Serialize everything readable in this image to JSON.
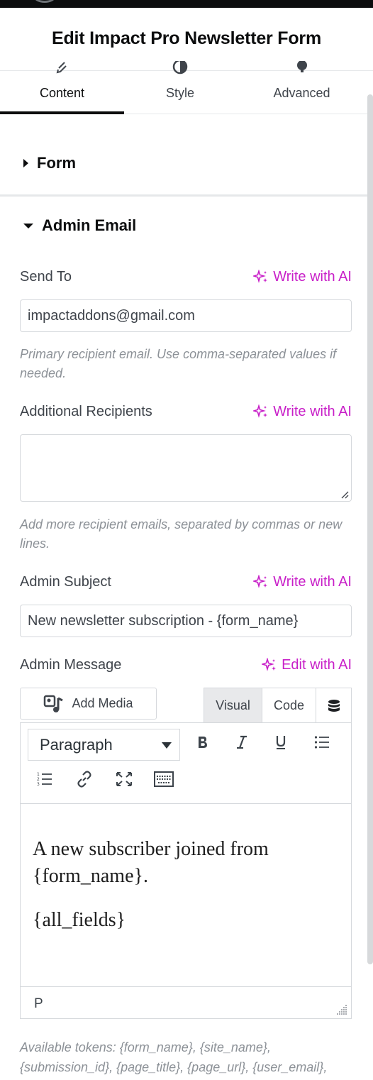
{
  "header": {
    "title": "Edit Impact Pro Newsletter Form"
  },
  "tabs": [
    {
      "label": "Content",
      "icon": "pencil-icon",
      "active": true
    },
    {
      "label": "Style",
      "icon": "half-circle-icon",
      "active": false
    },
    {
      "label": "Advanced",
      "icon": "gear-icon",
      "active": false
    }
  ],
  "sections": {
    "form": {
      "title": "Form",
      "expanded": false
    },
    "admin_email": {
      "title": "Admin Email",
      "expanded": true
    }
  },
  "fields": {
    "send_to": {
      "label": "Send To",
      "ai_label": "Write with AI",
      "value": "impactaddons@gmail.com",
      "help": "Primary recipient email. Use comma-separated values if needed."
    },
    "additional_recipients": {
      "label": "Additional Recipients",
      "ai_label": "Write with AI",
      "value": "",
      "help": "Add more recipient emails, separated by commas or new lines."
    },
    "admin_subject": {
      "label": "Admin Subject",
      "ai_label": "Write with AI",
      "value": "New newsletter subscription - {form_name}"
    },
    "admin_message": {
      "label": "Admin Message",
      "ai_label": "Edit with AI",
      "add_media": "Add Media",
      "editor_tabs": {
        "visual": "Visual",
        "code": "Code"
      },
      "format_select": "Paragraph",
      "paragraphs": [
        "A new subscriber joined from {form_name}.",
        "{all_fields}"
      ],
      "status_path": "P",
      "tokens_help": "Available tokens: {form_name}, {site_name}, {submission_id}, {page_title}, {page_url}, {user_email},"
    }
  },
  "colors": {
    "accent_ai": "#c81fc8",
    "text_dark": "#0c0d0e",
    "muted": "#8c9197"
  }
}
